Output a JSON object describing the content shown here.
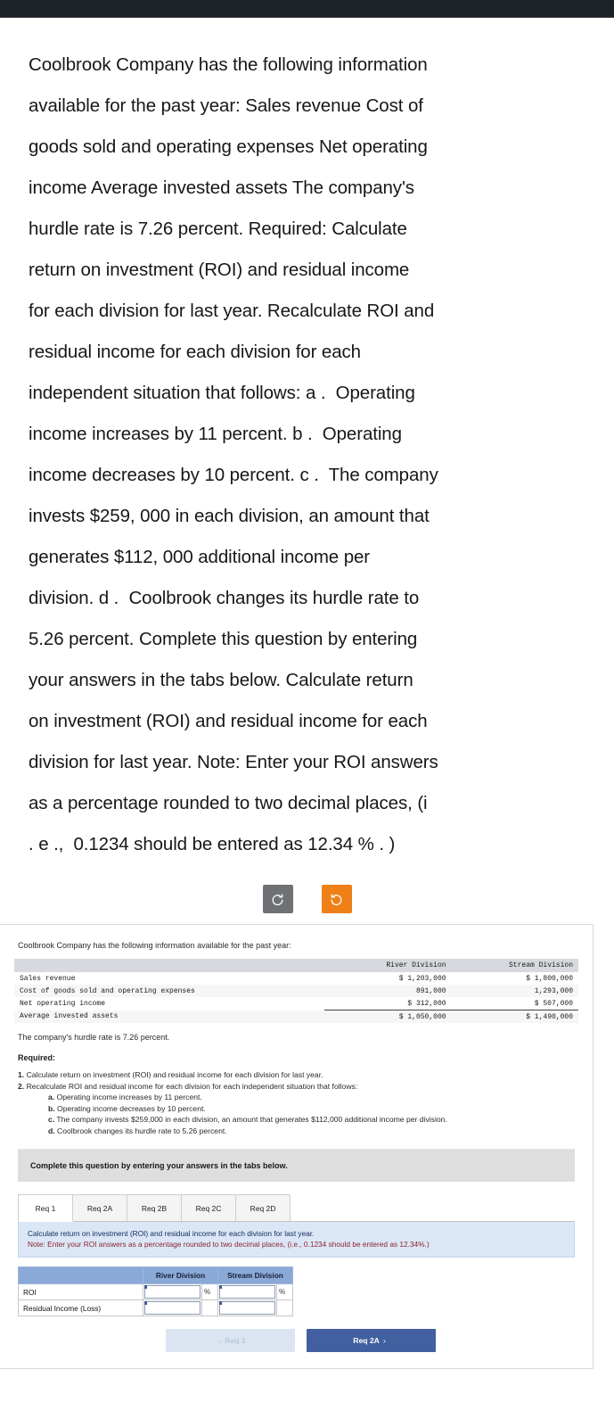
{
  "top_bar": {
    "color": "#1d2227"
  },
  "prose": {
    "lines": [
      "Coolbrook Company has the following information",
      "available for the past year: Sales revenue Cost of",
      "goods sold and operating expenses Net operating",
      "income Average invested assets The company's",
      "hurdle rate is 7.26 percent. Required: Calculate",
      "return on investment (ROI) and residual income",
      "for each division for last year. Recalculate ROI and",
      "residual income for each division for each",
      "independent situation that follows: a .  Operating",
      "income increases by 11 percent. b .  Operating",
      "income decreases by 10 percent. c .  The company",
      "invests $259, 000 in each division, an amount that",
      "generates $112, 000 additional income per",
      "division. d .  Coolbrook changes its hurdle rate to",
      "5.26 percent. Complete this question by entering",
      "your answers in the tabs below. Calculate return",
      "on investment (ROI) and residual income for each",
      "division for last year. Note: Enter your ROI answers",
      "as a percentage rounded to two decimal places, (i",
      ". e .,  0.1234 should be entered as 12.34 % . )"
    ]
  },
  "toolbar": {
    "undo_label": "undo",
    "redo_label": "redo",
    "undo_color": "#6f7175",
    "redo_color": "#ef8018"
  },
  "card": {
    "intro": "Coolbrook Company has the following information available for the past year:",
    "table": {
      "columns": [
        "",
        "River Division",
        "Stream Division"
      ],
      "rows": [
        {
          "label": "Sales revenue",
          "river": "$ 1,203,000",
          "stream": "$ 1,800,000"
        },
        {
          "label": "Cost of goods sold and operating expenses",
          "river": "891,000",
          "stream": "1,293,000"
        },
        {
          "label": "Net operating income",
          "river": "$ 312,000",
          "stream": "$ 507,000"
        },
        {
          "label": "Average invested assets",
          "river": "$ 1,050,000",
          "stream": "$ 1,490,000"
        }
      ]
    },
    "hurdle": "The company's hurdle rate is 7.26 percent.",
    "required_heading": "Required:",
    "required": [
      {
        "marker": "1.",
        "text": "Calculate return on investment (ROI) and residual income for each division for last year."
      },
      {
        "marker": "2.",
        "text": "Recalculate ROI and residual income for each division for each independent situation that follows:"
      }
    ],
    "sub_required": [
      {
        "marker": "a.",
        "text": "Operating income increases by 11 percent."
      },
      {
        "marker": "b.",
        "text": "Operating income decreases by 10 percent."
      },
      {
        "marker": "c.",
        "text": "The company invests $259,000 in each division, an amount that generates $112,000 additional income per division."
      },
      {
        "marker": "d.",
        "text": "Coolbrook changes its hurdle rate to 5.26 percent."
      }
    ],
    "complete_banner": "Complete this question by entering your answers in the tabs below.",
    "tabs": [
      {
        "label": "Req 1",
        "active": true
      },
      {
        "label": "Req 2A",
        "active": false
      },
      {
        "label": "Req 2B",
        "active": false
      },
      {
        "label": "Req 2C",
        "active": false
      },
      {
        "label": "Req 2D",
        "active": false
      }
    ],
    "instruction": {
      "line1": "Calculate return on investment (ROI) and residual income for each division for last year.",
      "line2": "Note: Enter your ROI answers as a percentage rounded to two decimal places, (i.e., 0.1234 should be entered as 12.34%.)"
    },
    "answer_table": {
      "columns": [
        "",
        "River Division",
        "Stream Division"
      ],
      "rows": [
        {
          "label": "ROI",
          "river_value": "",
          "stream_value": "",
          "suffix": "%"
        },
        {
          "label": "Residual Income (Loss)",
          "river_value": "",
          "stream_value": "",
          "suffix": ""
        }
      ]
    },
    "nav": {
      "prev_label": "Req 1",
      "next_label": "Req 2A",
      "prev_chevron": "‹",
      "next_chevron": "›"
    }
  }
}
